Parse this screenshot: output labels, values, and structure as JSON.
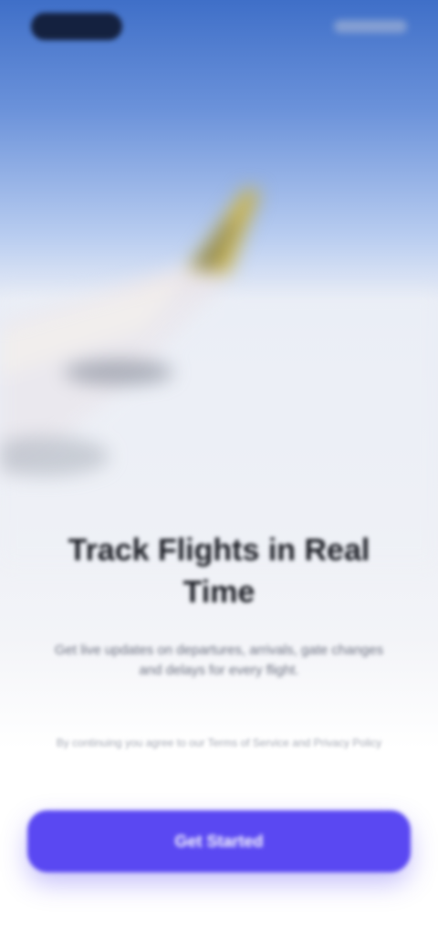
{
  "onboarding": {
    "title": "Track Flights in Real Time",
    "subtitle": "Get live updates on departures, arrivals, gate changes and delays for every flight.",
    "terms": "By continuing you agree to our Terms of Service and Privacy Policy",
    "cta_label": "Get Started"
  },
  "colors": {
    "accent": "#5a48f2",
    "sky_top": "#3f6fc8",
    "wing_tip": "#c9b24a"
  },
  "icons": {
    "background": "airplane-wing-photo"
  }
}
